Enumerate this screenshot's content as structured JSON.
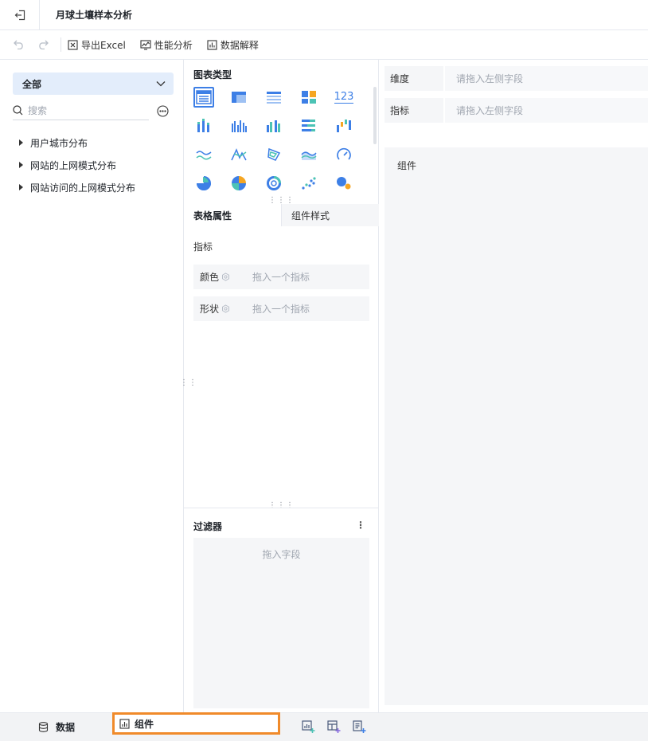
{
  "header": {
    "title": "月球土壤样本分析"
  },
  "toolbar": {
    "undo_icon": "undo-icon",
    "redo_icon": "redo-icon",
    "export_label": "导出Excel",
    "performance_label": "性能分析",
    "explain_label": "数据解释"
  },
  "data_panel": {
    "select_value": "全部",
    "search_placeholder": "搜索",
    "tree": [
      {
        "label": "用户城市分布"
      },
      {
        "label": "网站的上网模式分布"
      },
      {
        "label": "网站访问的上网模式分布"
      }
    ]
  },
  "chart_panel": {
    "title": "图表类型",
    "number_chart_label": "123",
    "tabs": {
      "table_props": "表格属性",
      "component_style": "组件样式"
    },
    "metrics_label": "指标",
    "props": [
      {
        "label": "颜色",
        "placeholder": "拖入一个指标"
      },
      {
        "label": "形状",
        "placeholder": "拖入一个指标"
      }
    ],
    "filter": {
      "title": "过滤器",
      "more": "⋮",
      "placeholder": "拖入字段"
    }
  },
  "canvas": {
    "dimension_label": "维度",
    "dimension_placeholder": "请拖入左侧字段",
    "metric_label": "指标",
    "metric_placeholder": "请拖入左侧字段",
    "component_label": "组件"
  },
  "bottom": {
    "data_tab": "数据",
    "component_tab": "组件"
  },
  "colors": {
    "accent": "#3d7fe6",
    "highlight_border": "#f08a2a",
    "select_bg": "#e3edfb"
  }
}
